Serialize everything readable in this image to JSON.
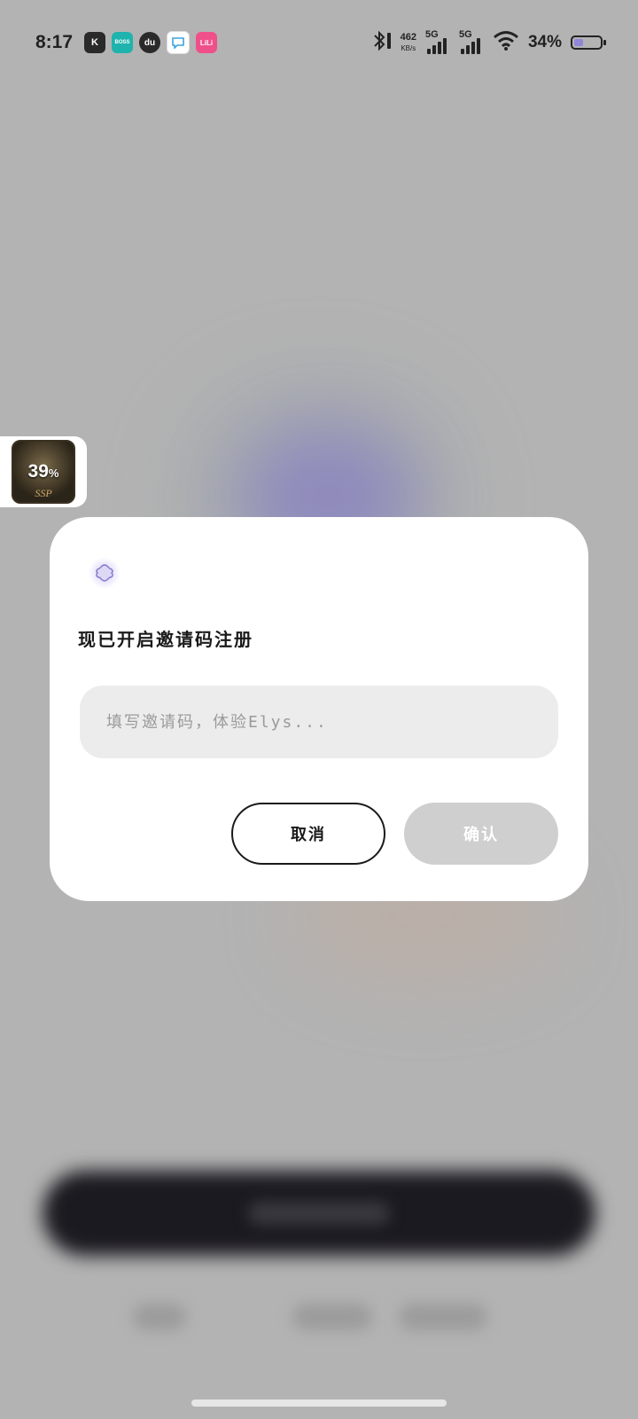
{
  "status_bar": {
    "time": "8:17",
    "apps": [
      {
        "icon": "kuaishou-k-icon",
        "label": "K",
        "color": "#2a2a2a"
      },
      {
        "icon": "boss-zhipin-icon",
        "label": "BOSS",
        "color": "#1fb3ad"
      },
      {
        "icon": "dewu-icon",
        "label": "du",
        "color": "#2a2a2a"
      },
      {
        "icon": "chat-bubble-icon",
        "label": "",
        "color": "#ffffff"
      },
      {
        "icon": "bilibili-icon",
        "label": "LiLi",
        "color": "#f0508a"
      }
    ],
    "network_speed_value": "462",
    "network_speed_unit": "KB/s",
    "signal1_label": "5G",
    "signal2_label": "5G",
    "battery_percent": "34%",
    "battery_level": 0.34
  },
  "floating_widget": {
    "percent": "39",
    "percent_sign": "%",
    "sub_label": "SSP"
  },
  "dialog": {
    "title": "现已开启邀请码注册",
    "input_placeholder": "填写邀请码，体验Elys...",
    "input_value": "",
    "cancel_label": "取消",
    "confirm_label": "确认"
  },
  "colors": {
    "overlay": "#b3b3b3",
    "accent_purple": "#8f86d8",
    "confirm_disabled": "#cfcfcf"
  }
}
